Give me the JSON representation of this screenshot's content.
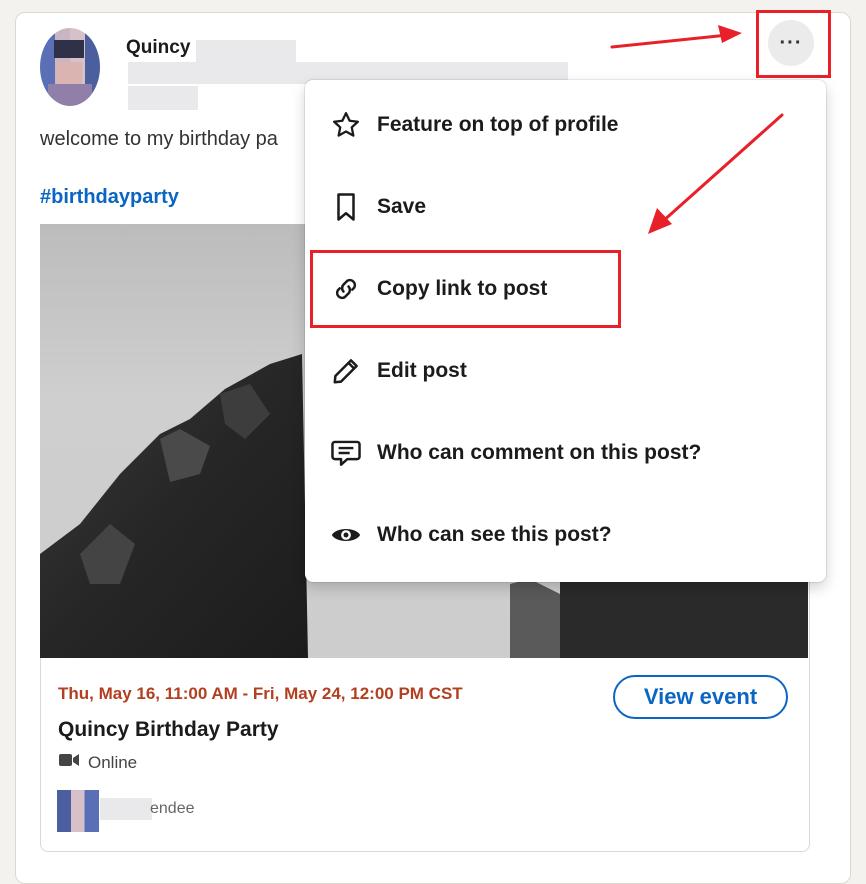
{
  "post": {
    "author_name": "Quincy",
    "text": "welcome to my birthday pa",
    "hashtag": "#birthdayparty"
  },
  "event": {
    "date_range": "Thu, May 16, 11:00 AM - Fri, May 24, 12:00 PM CST",
    "title": "Quincy Birthday Party",
    "location": "Online",
    "view_button": "View event",
    "attendee_text": "endee"
  },
  "more_button": {
    "label": "···"
  },
  "menu": {
    "items": [
      {
        "label": "Feature on top of profile",
        "icon": "star-icon"
      },
      {
        "label": "Save",
        "icon": "bookmark-icon"
      },
      {
        "label": "Copy link to post",
        "icon": "link-icon"
      },
      {
        "label": "Edit post",
        "icon": "pencil-icon"
      },
      {
        "label": "Who can comment on this post?",
        "icon": "comment-icon"
      },
      {
        "label": "Who can see this post?",
        "icon": "eye-icon"
      }
    ]
  },
  "colors": {
    "accent": "#0a66c2",
    "date_color": "#b24020",
    "annotation_red": "#e8202a"
  }
}
